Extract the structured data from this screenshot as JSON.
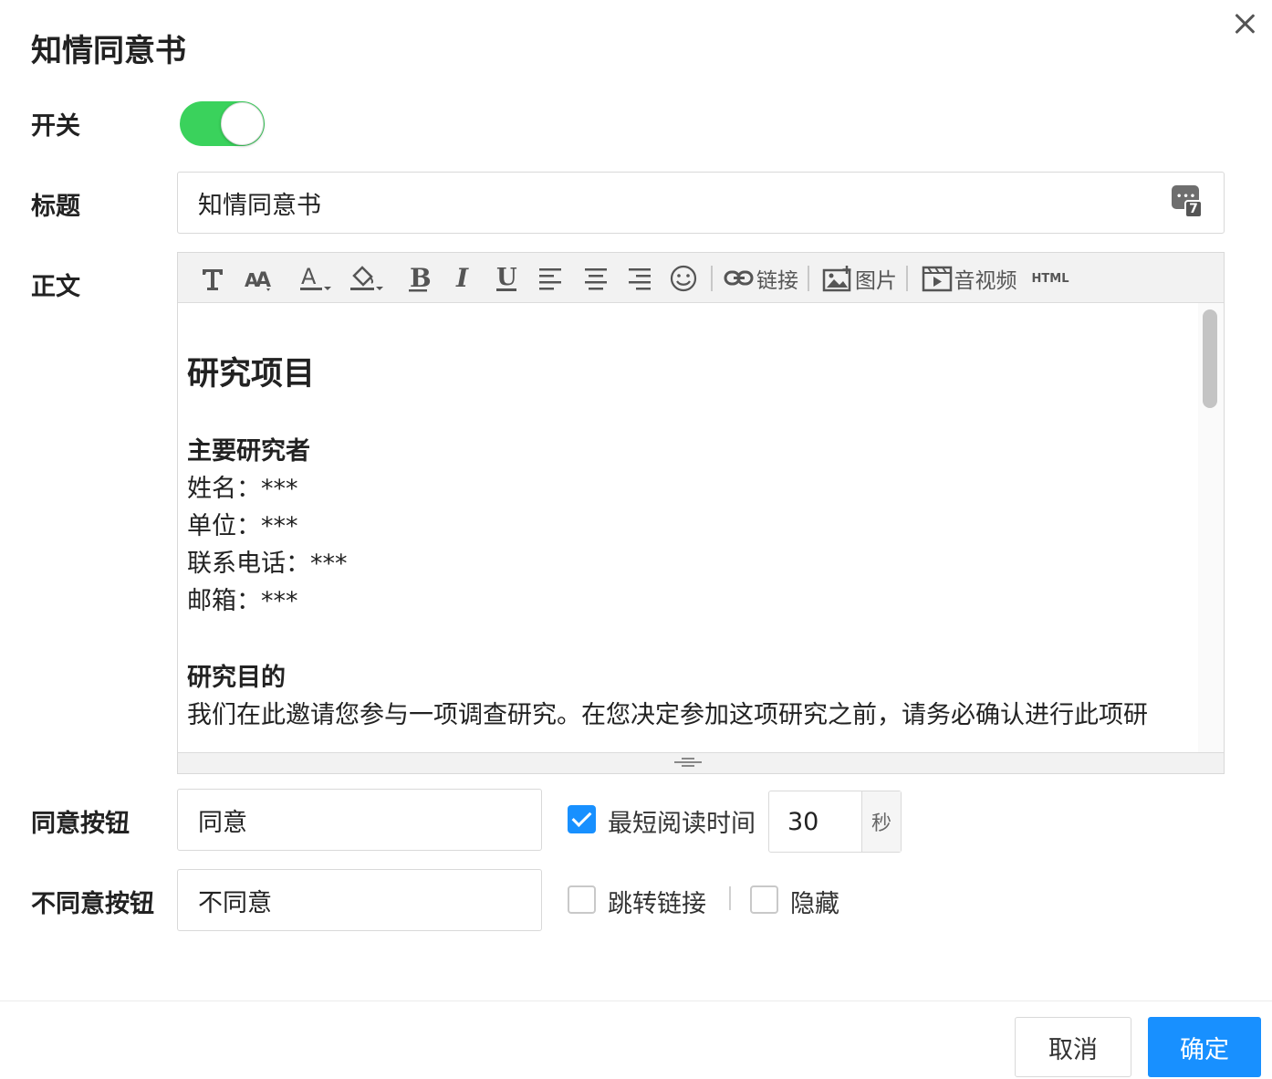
{
  "dialog": {
    "title": "知情同意书"
  },
  "form": {
    "switch": {
      "label": "开关",
      "on": true,
      "color": "#3ad25c"
    },
    "title_field": {
      "label": "标题",
      "value": "知情同意书",
      "emoji_badge": "7"
    },
    "body_field": {
      "label": "正文",
      "toolbar": {
        "link_label": "链接",
        "image_label": "图片",
        "media_label": "音视频",
        "html_label": "HTML"
      },
      "content": {
        "heading": "研究项目",
        "pi_heading": "主要研究者",
        "name": "姓名：***",
        "unit": "单位：***",
        "phone": "联系电话：***",
        "email": "邮箱：***",
        "purpose_heading": "研究目的",
        "purpose_text": "我们在此邀请您参与一项调查研究。在您决定参加这项研究之前，请务必确认进行此项研"
      }
    },
    "agree_button": {
      "label": "同意按钮",
      "value": "同意"
    },
    "min_read": {
      "label": "最短阅读时间",
      "checked": true,
      "value": "30",
      "unit": "秒"
    },
    "disagree_button": {
      "label": "不同意按钮",
      "value": "不同意"
    },
    "redirect": {
      "label": "跳转链接",
      "checked": false
    },
    "hide": {
      "label": "隐藏",
      "checked": false
    }
  },
  "footer": {
    "cancel": "取消",
    "ok": "确定",
    "accent": "#1890ff"
  }
}
